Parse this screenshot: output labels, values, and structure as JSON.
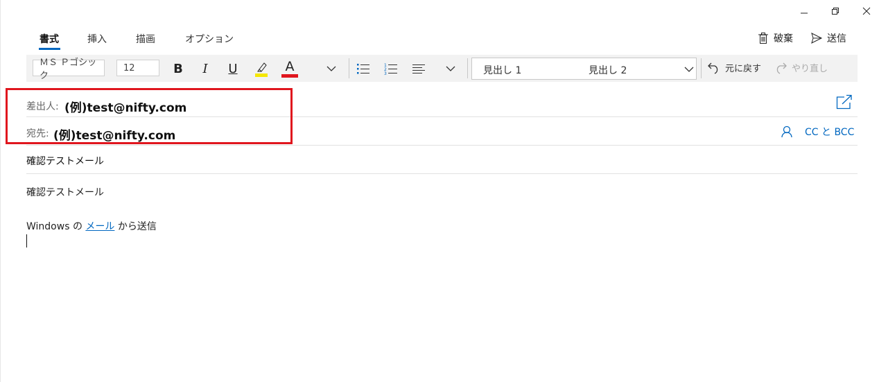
{
  "window": {
    "controls": {
      "minimize": "minimize",
      "restore": "restore",
      "close": "close"
    }
  },
  "ribbon": {
    "tabs": [
      {
        "label": "書式",
        "active": true
      },
      {
        "label": "挿入",
        "active": false
      },
      {
        "label": "描画",
        "active": false
      },
      {
        "label": "オプション",
        "active": false
      }
    ],
    "actions": {
      "discard": "破棄",
      "send": "送信"
    }
  },
  "toolbar": {
    "font_name": "ＭＳ Ｐゴシック",
    "font_size": "12",
    "bold": "B",
    "italic": "I",
    "underline": "U",
    "font_color": "A",
    "highlight_color": "#f5e700",
    "text_color": "#e0161e",
    "styles": {
      "heading1": "見出し 1",
      "heading2": "見出し 2"
    },
    "undo": "元に戻す",
    "redo": "やり直し"
  },
  "header": {
    "from_label": "差出人:",
    "from_value": "(例)test@nifty.com",
    "to_label": "宛先:",
    "to_value": "(例)test@nifty.com",
    "cc_bcc": "CC と BCC",
    "highlight_color": "#e0161e"
  },
  "message": {
    "subject": "確認テストメール",
    "body_line1": "確認テストメール",
    "signature_prefix": "Windows の",
    "signature_link": "メール",
    "signature_suffix": "から送信"
  },
  "accent_color": "#0067c0"
}
